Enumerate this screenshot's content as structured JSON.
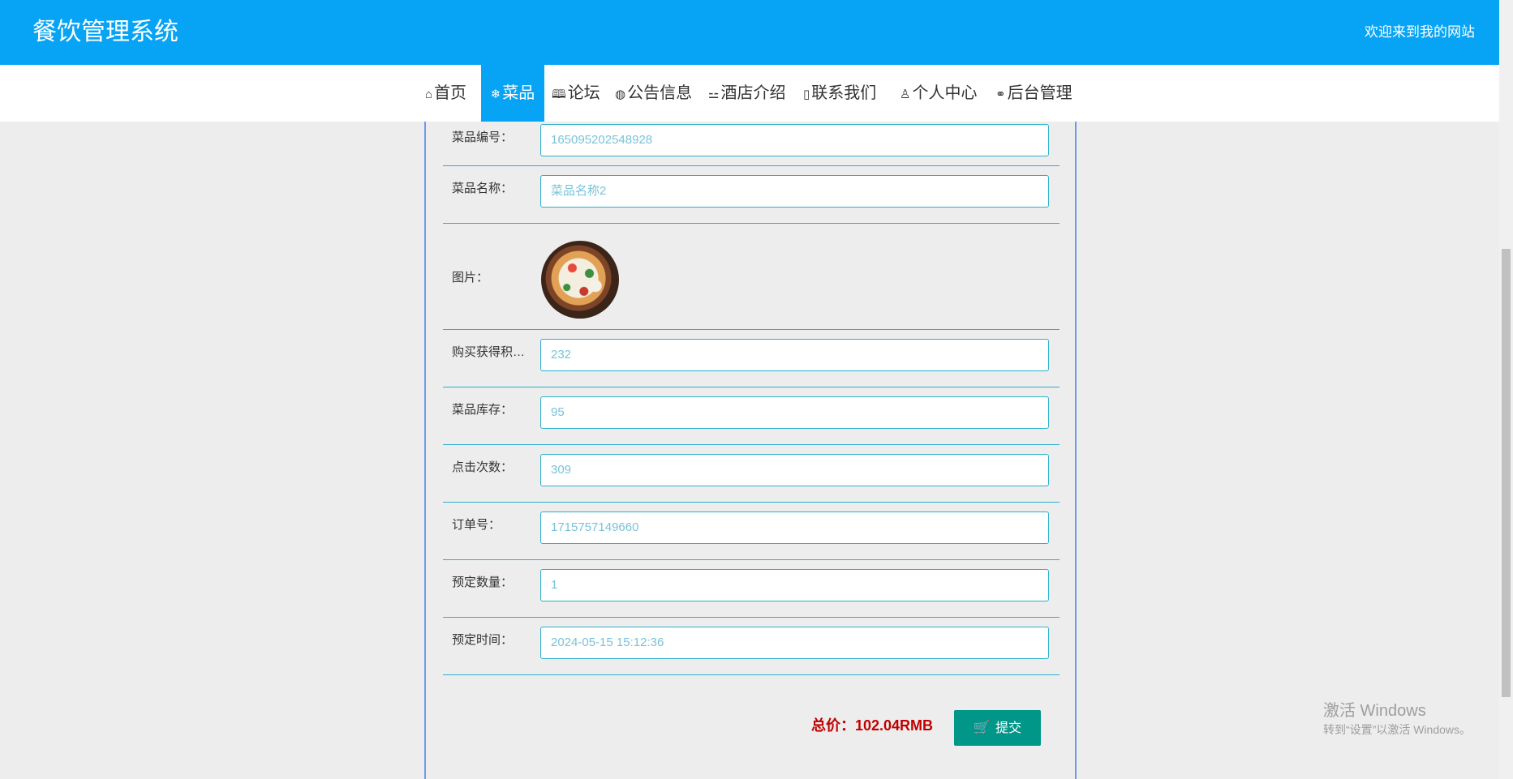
{
  "header": {
    "title": "餐饮管理系统",
    "welcome": "欢迎来到我的网站"
  },
  "nav": {
    "items": [
      {
        "icon": "⌂",
        "label": "首页"
      },
      {
        "icon": "❄",
        "label": "菜品"
      },
      {
        "icon": "🕮",
        "label": "论坛"
      },
      {
        "icon": "◍",
        "label": "公告信息"
      },
      {
        "icon": "⚍",
        "label": "酒店介绍"
      },
      {
        "icon": "▯",
        "label": "联系我们"
      },
      {
        "icon": "♙",
        "label": "个人中心"
      },
      {
        "icon": "⚭",
        "label": "后台管理"
      }
    ],
    "active": "菜品"
  },
  "form": {
    "code": {
      "label": "菜品编号：",
      "value": "165095202548928"
    },
    "name": {
      "label": "菜品名称：",
      "value": "菜品名称2"
    },
    "image": {
      "label": "图片："
    },
    "points": {
      "label": "购买获得积分：",
      "value": "232"
    },
    "stock": {
      "label": "菜品库存：",
      "value": "95"
    },
    "clicks": {
      "label": "点击次数：",
      "value": "309"
    },
    "order": {
      "label": "订单号：",
      "value": "1715757149660"
    },
    "qty": {
      "label": "预定数量：",
      "value": "1"
    },
    "time": {
      "label": "预定时间：",
      "value": "2024-05-15 15:12:36"
    }
  },
  "summary": {
    "total": "总价：102.04RMB",
    "submit_label": "提交",
    "cart_icon": "🛒"
  },
  "watermark": {
    "line1": "激活 Windows",
    "line2": "转到“设置”以激活 Windows。"
  }
}
